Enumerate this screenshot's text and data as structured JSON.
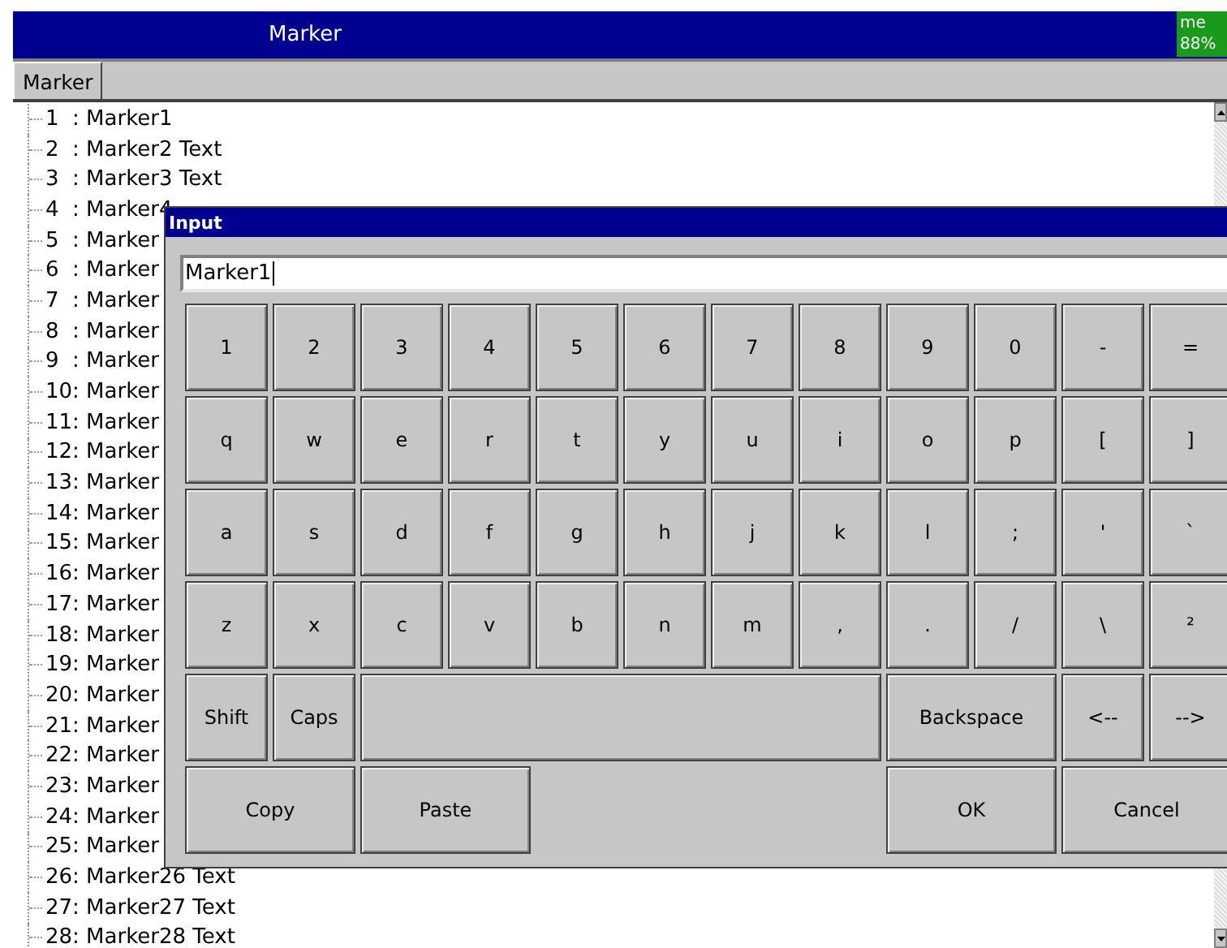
{
  "window": {
    "title": "Marker",
    "memory": {
      "label": "me",
      "value": "88%"
    }
  },
  "tabs": [
    {
      "label": "Marker",
      "selected": true
    }
  ],
  "markers": [
    {
      "label": "1  : Marker1"
    },
    {
      "label": "2  : Marker2 Text"
    },
    {
      "label": "3  : Marker3 Text"
    },
    {
      "label": "4  : Marker4"
    },
    {
      "label": "5  : Marker"
    },
    {
      "label": "6  : Marker"
    },
    {
      "label": "7  : Marker"
    },
    {
      "label": "8  : Marker"
    },
    {
      "label": "9  : Marker"
    },
    {
      "label": "10: Marker"
    },
    {
      "label": "11: Marker"
    },
    {
      "label": "12: Marker"
    },
    {
      "label": "13: Marker"
    },
    {
      "label": "14: Marker"
    },
    {
      "label": "15: Marker"
    },
    {
      "label": "16: Marker"
    },
    {
      "label": "17: Marker"
    },
    {
      "label": "18: Marker"
    },
    {
      "label": "19: Marker"
    },
    {
      "label": "20: Marker"
    },
    {
      "label": "21: Marker"
    },
    {
      "label": "22: Marker"
    },
    {
      "label": "23: Marker"
    },
    {
      "label": "24: Marker"
    },
    {
      "label": "25: Marker"
    },
    {
      "label": "26: Marker26 Text"
    },
    {
      "label": "27: Marker27 Text"
    },
    {
      "label": "28: Marker28 Text"
    }
  ],
  "dialog": {
    "title": "Input",
    "value": "Marker1",
    "keys": [
      [
        {
          "label": "1"
        },
        {
          "label": "2"
        },
        {
          "label": "3"
        },
        {
          "label": "4"
        },
        {
          "label": "5"
        },
        {
          "label": "6"
        },
        {
          "label": "7"
        },
        {
          "label": "8"
        },
        {
          "label": "9"
        },
        {
          "label": "0"
        },
        {
          "label": "-"
        },
        {
          "label": "="
        }
      ],
      [
        {
          "label": "q"
        },
        {
          "label": "w"
        },
        {
          "label": "e"
        },
        {
          "label": "r"
        },
        {
          "label": "t"
        },
        {
          "label": "y"
        },
        {
          "label": "u"
        },
        {
          "label": "i"
        },
        {
          "label": "o"
        },
        {
          "label": "p"
        },
        {
          "label": "["
        },
        {
          "label": "]"
        }
      ],
      [
        {
          "label": "a"
        },
        {
          "label": "s"
        },
        {
          "label": "d"
        },
        {
          "label": "f"
        },
        {
          "label": "g"
        },
        {
          "label": "h"
        },
        {
          "label": "j"
        },
        {
          "label": "k"
        },
        {
          "label": "l"
        },
        {
          "label": ";"
        },
        {
          "label": "'"
        },
        {
          "label": "`"
        }
      ],
      [
        {
          "label": "z"
        },
        {
          "label": "x"
        },
        {
          "label": "c"
        },
        {
          "label": "v"
        },
        {
          "label": "b"
        },
        {
          "label": "n"
        },
        {
          "label": "m"
        },
        {
          "label": ","
        },
        {
          "label": "."
        },
        {
          "label": "/"
        },
        {
          "label": "\\"
        },
        {
          "label": "²"
        }
      ],
      [
        {
          "label": "Shift"
        },
        {
          "label": "Caps"
        },
        {
          "kind": "space"
        },
        {
          "label": "Backspace",
          "kind": "wide"
        },
        {
          "label": "<--"
        },
        {
          "label": "-->"
        }
      ],
      [
        {
          "label": "Copy",
          "kind": "wide"
        },
        {
          "label": "Paste",
          "kind": "wide"
        },
        {
          "kind": "gap"
        },
        {
          "label": "OK",
          "kind": "wide"
        },
        {
          "label": "Cancel",
          "kind": "wide"
        }
      ]
    ]
  }
}
